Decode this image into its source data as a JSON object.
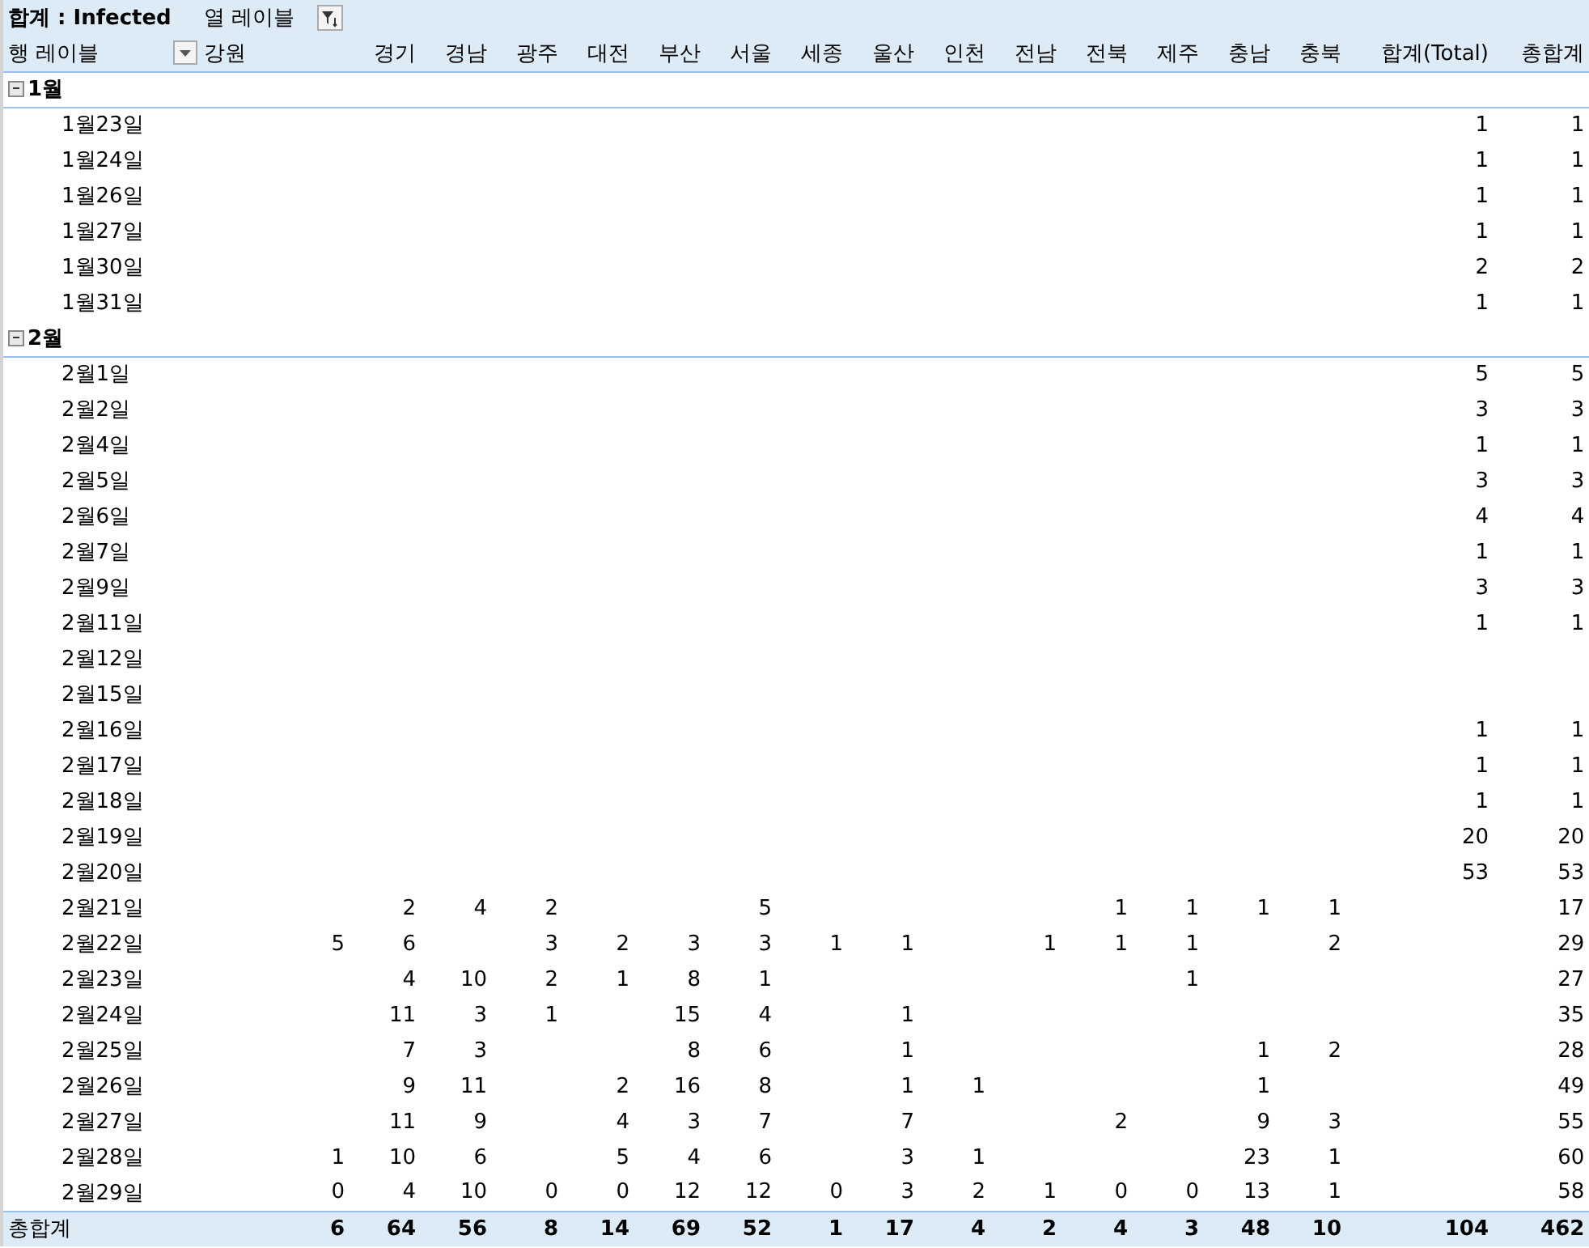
{
  "pivot": {
    "value_label": "합계 : Infected",
    "column_label": "열 레이블",
    "row_label": "행 레이블",
    "columns": [
      "강원",
      "경기",
      "경남",
      "광주",
      "대전",
      "부산",
      "서울",
      "세종",
      "울산",
      "인천",
      "전남",
      "전북",
      "제주",
      "충남",
      "충북",
      "합계(Total)",
      "총합계"
    ],
    "groups": [
      {
        "label": "1월",
        "expanded": true,
        "rows": [
          {
            "label": "1월23일",
            "cells": [
              null,
              null,
              null,
              null,
              null,
              null,
              null,
              null,
              null,
              null,
              null,
              null,
              null,
              null,
              null,
              "1",
              "1"
            ]
          },
          {
            "label": "1월24일",
            "cells": [
              null,
              null,
              null,
              null,
              null,
              null,
              null,
              null,
              null,
              null,
              null,
              null,
              null,
              null,
              null,
              "1",
              "1"
            ]
          },
          {
            "label": "1월26일",
            "cells": [
              null,
              null,
              null,
              null,
              null,
              null,
              null,
              null,
              null,
              null,
              null,
              null,
              null,
              null,
              null,
              "1",
              "1"
            ]
          },
          {
            "label": "1월27일",
            "cells": [
              null,
              null,
              null,
              null,
              null,
              null,
              null,
              null,
              null,
              null,
              null,
              null,
              null,
              null,
              null,
              "1",
              "1"
            ]
          },
          {
            "label": "1월30일",
            "cells": [
              null,
              null,
              null,
              null,
              null,
              null,
              null,
              null,
              null,
              null,
              null,
              null,
              null,
              null,
              null,
              "2",
              "2"
            ]
          },
          {
            "label": "1월31일",
            "cells": [
              null,
              null,
              null,
              null,
              null,
              null,
              null,
              null,
              null,
              null,
              null,
              null,
              null,
              null,
              null,
              "1",
              "1"
            ]
          }
        ]
      },
      {
        "label": "2월",
        "expanded": true,
        "rows": [
          {
            "label": "2월1일",
            "cells": [
              null,
              null,
              null,
              null,
              null,
              null,
              null,
              null,
              null,
              null,
              null,
              null,
              null,
              null,
              null,
              "5",
              "5"
            ]
          },
          {
            "label": "2월2일",
            "cells": [
              null,
              null,
              null,
              null,
              null,
              null,
              null,
              null,
              null,
              null,
              null,
              null,
              null,
              null,
              null,
              "3",
              "3"
            ]
          },
          {
            "label": "2월4일",
            "cells": [
              null,
              null,
              null,
              null,
              null,
              null,
              null,
              null,
              null,
              null,
              null,
              null,
              null,
              null,
              null,
              "1",
              "1"
            ]
          },
          {
            "label": "2월5일",
            "cells": [
              null,
              null,
              null,
              null,
              null,
              null,
              null,
              null,
              null,
              null,
              null,
              null,
              null,
              null,
              null,
              "3",
              "3"
            ]
          },
          {
            "label": "2월6일",
            "cells": [
              null,
              null,
              null,
              null,
              null,
              null,
              null,
              null,
              null,
              null,
              null,
              null,
              null,
              null,
              null,
              "4",
              "4"
            ]
          },
          {
            "label": "2월7일",
            "cells": [
              null,
              null,
              null,
              null,
              null,
              null,
              null,
              null,
              null,
              null,
              null,
              null,
              null,
              null,
              null,
              "1",
              "1"
            ]
          },
          {
            "label": "2월9일",
            "cells": [
              null,
              null,
              null,
              null,
              null,
              null,
              null,
              null,
              null,
              null,
              null,
              null,
              null,
              null,
              null,
              "3",
              "3"
            ]
          },
          {
            "label": "2월11일",
            "cells": [
              null,
              null,
              null,
              null,
              null,
              null,
              null,
              null,
              null,
              null,
              null,
              null,
              null,
              null,
              null,
              "1",
              "1"
            ]
          },
          {
            "label": "2월12일",
            "cells": [
              null,
              null,
              null,
              null,
              null,
              null,
              null,
              null,
              null,
              null,
              null,
              null,
              null,
              null,
              null,
              null,
              null
            ]
          },
          {
            "label": "2월15일",
            "cells": [
              null,
              null,
              null,
              null,
              null,
              null,
              null,
              null,
              null,
              null,
              null,
              null,
              null,
              null,
              null,
              null,
              null
            ]
          },
          {
            "label": "2월16일",
            "cells": [
              null,
              null,
              null,
              null,
              null,
              null,
              null,
              null,
              null,
              null,
              null,
              null,
              null,
              null,
              null,
              "1",
              "1"
            ]
          },
          {
            "label": "2월17일",
            "cells": [
              null,
              null,
              null,
              null,
              null,
              null,
              null,
              null,
              null,
              null,
              null,
              null,
              null,
              null,
              null,
              "1",
              "1"
            ]
          },
          {
            "label": "2월18일",
            "cells": [
              null,
              null,
              null,
              null,
              null,
              null,
              null,
              null,
              null,
              null,
              null,
              null,
              null,
              null,
              null,
              "1",
              "1"
            ]
          },
          {
            "label": "2월19일",
            "cells": [
              null,
              null,
              null,
              null,
              null,
              null,
              null,
              null,
              null,
              null,
              null,
              null,
              null,
              null,
              null,
              "20",
              "20"
            ]
          },
          {
            "label": "2월20일",
            "cells": [
              null,
              null,
              null,
              null,
              null,
              null,
              null,
              null,
              null,
              null,
              null,
              null,
              null,
              null,
              null,
              "53",
              "53"
            ]
          },
          {
            "label": "2월21일",
            "cells": [
              null,
              "2",
              "4",
              "2",
              null,
              null,
              "5",
              null,
              null,
              null,
              null,
              "1",
              "1",
              "1",
              "1",
              null,
              "17"
            ]
          },
          {
            "label": "2월22일",
            "cells": [
              "5",
              "6",
              null,
              "3",
              "2",
              "3",
              "3",
              "1",
              "1",
              null,
              "1",
              "1",
              "1",
              null,
              "2",
              null,
              "29"
            ]
          },
          {
            "label": "2월23일",
            "cells": [
              null,
              "4",
              "10",
              "2",
              "1",
              "8",
              "1",
              null,
              null,
              null,
              null,
              null,
              "1",
              null,
              null,
              null,
              "27"
            ]
          },
          {
            "label": "2월24일",
            "cells": [
              null,
              "11",
              "3",
              "1",
              null,
              "15",
              "4",
              null,
              "1",
              null,
              null,
              null,
              null,
              null,
              null,
              null,
              "35"
            ]
          },
          {
            "label": "2월25일",
            "cells": [
              null,
              "7",
              "3",
              null,
              null,
              "8",
              "6",
              null,
              "1",
              null,
              null,
              null,
              null,
              "1",
              "2",
              null,
              "28"
            ]
          },
          {
            "label": "2월26일",
            "cells": [
              null,
              "9",
              "11",
              null,
              "2",
              "16",
              "8",
              null,
              "1",
              "1",
              null,
              null,
              null,
              "1",
              null,
              null,
              "49"
            ]
          },
          {
            "label": "2월27일",
            "cells": [
              null,
              "11",
              "9",
              null,
              "4",
              "3",
              "7",
              null,
              "7",
              null,
              null,
              "2",
              null,
              "9",
              "3",
              null,
              "55"
            ]
          },
          {
            "label": "2월28일",
            "cells": [
              "1",
              "10",
              "6",
              null,
              "5",
              "4",
              "6",
              null,
              "3",
              "1",
              null,
              null,
              null,
              "23",
              "1",
              null,
              "60"
            ]
          },
          {
            "label": "2월29일",
            "cells": [
              "0",
              "4",
              "10",
              "0",
              "0",
              "12",
              "12",
              "0",
              "3",
              "2",
              "1",
              "0",
              "0",
              "13",
              "1",
              null,
              "58"
            ]
          }
        ]
      }
    ],
    "total": {
      "label": "총합계",
      "cells": [
        "6",
        "64",
        "56",
        "8",
        "14",
        "69",
        "52",
        "1",
        "17",
        "4",
        "2",
        "4",
        "3",
        "48",
        "10",
        "104",
        "462"
      ]
    }
  }
}
